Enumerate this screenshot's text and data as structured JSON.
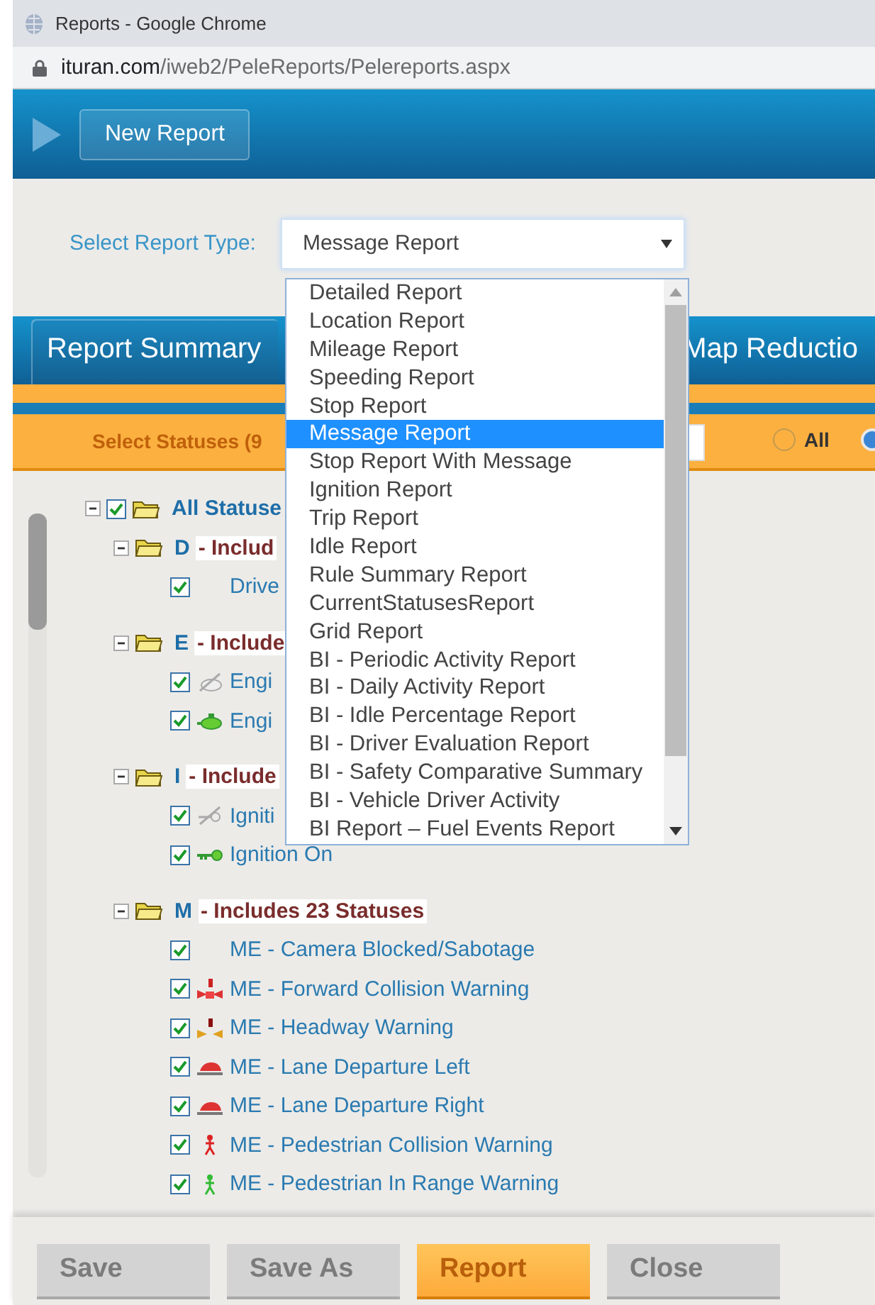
{
  "browser": {
    "title": "Reports - Google Chrome",
    "url_host": "ituran.com",
    "url_path": "/iweb2/PeleReports/Pelereports.aspx"
  },
  "header": {
    "new_report_button": "New Report"
  },
  "report_type": {
    "label": "Select Report Type:",
    "value": "Message Report",
    "options": [
      {
        "label": "Detailed Report",
        "selected": false
      },
      {
        "label": "Location Report",
        "selected": false
      },
      {
        "label": "Mileage Report",
        "selected": false
      },
      {
        "label": "Speeding Report",
        "selected": false
      },
      {
        "label": "Stop Report",
        "selected": false
      },
      {
        "label": "Message Report",
        "selected": true
      },
      {
        "label": "Stop Report With Message",
        "selected": false
      },
      {
        "label": "Ignition Report",
        "selected": false
      },
      {
        "label": "Trip Report",
        "selected": false
      },
      {
        "label": "Idle Report",
        "selected": false
      },
      {
        "label": "Rule Summary Report",
        "selected": false
      },
      {
        "label": "CurrentStatusesReport",
        "selected": false
      },
      {
        "label": "Grid Report",
        "selected": false
      },
      {
        "label": "BI - Periodic Activity Report",
        "selected": false
      },
      {
        "label": "BI - Daily Activity Report",
        "selected": false
      },
      {
        "label": "BI - Idle Percentage Report",
        "selected": false
      },
      {
        "label": "BI - Driver Evaluation Report",
        "selected": false
      },
      {
        "label": "BI - Safety Comparative Summary",
        "selected": false
      },
      {
        "label": "BI - Vehicle Driver Activity",
        "selected": false
      },
      {
        "label": "BI Report – Fuel Events Report",
        "selected": false
      }
    ]
  },
  "tabs": [
    {
      "label": "Report Summary",
      "selected": true
    },
    {
      "label": "Map Reductio",
      "selected": false
    }
  ],
  "statuses_bar": {
    "label": "Select Statuses (9",
    "radios": [
      {
        "label": "All",
        "selected": false
      },
      {
        "selected": true
      }
    ]
  },
  "tree": {
    "label": "All Statuse",
    "checked": true,
    "expanded": true,
    "groups": [
      {
        "letter": "D",
        "description": "- Includ",
        "expanded": true,
        "children": [
          {
            "label": "Drive",
            "checked": true,
            "kind": "none"
          }
        ]
      },
      {
        "letter": "E",
        "description": "- Include",
        "expanded": true,
        "children": [
          {
            "label": "Engi",
            "checked": true,
            "kind": "engine-off"
          },
          {
            "label": "Engi",
            "checked": true,
            "kind": "engine-on"
          }
        ]
      },
      {
        "letter": "I",
        "description": "- Include",
        "expanded": true,
        "children": [
          {
            "label": "Igniti",
            "checked": true,
            "kind": "key-off"
          },
          {
            "label": "Ignition On",
            "checked": true,
            "kind": "key-on"
          }
        ]
      },
      {
        "letter": "M",
        "description": "- Includes 23 Statuses",
        "expanded": true,
        "children": [
          {
            "label": "ME - Camera Blocked/Sabotage",
            "checked": true,
            "kind": "none"
          },
          {
            "label": "ME - Forward Collision Warning",
            "checked": true,
            "kind": "collision"
          },
          {
            "label": "ME - Headway Warning",
            "checked": true,
            "kind": "headway"
          },
          {
            "label": "ME - Lane Departure Left",
            "checked": true,
            "kind": "lane"
          },
          {
            "label": "ME - Lane Departure Right",
            "checked": true,
            "kind": "lane"
          },
          {
            "label": "ME - Pedestrian Collision Warning",
            "checked": true,
            "kind": "pedestrian-red"
          },
          {
            "label": "ME - Pedestrian In Range Warning",
            "checked": true,
            "kind": "pedestrian-green"
          }
        ]
      }
    ]
  },
  "buttons": [
    {
      "label": "Save",
      "kind": "default"
    },
    {
      "label": "Save As",
      "kind": "default"
    },
    {
      "label": "Report",
      "kind": "primary"
    },
    {
      "label": "Close",
      "kind": "default"
    }
  ]
}
